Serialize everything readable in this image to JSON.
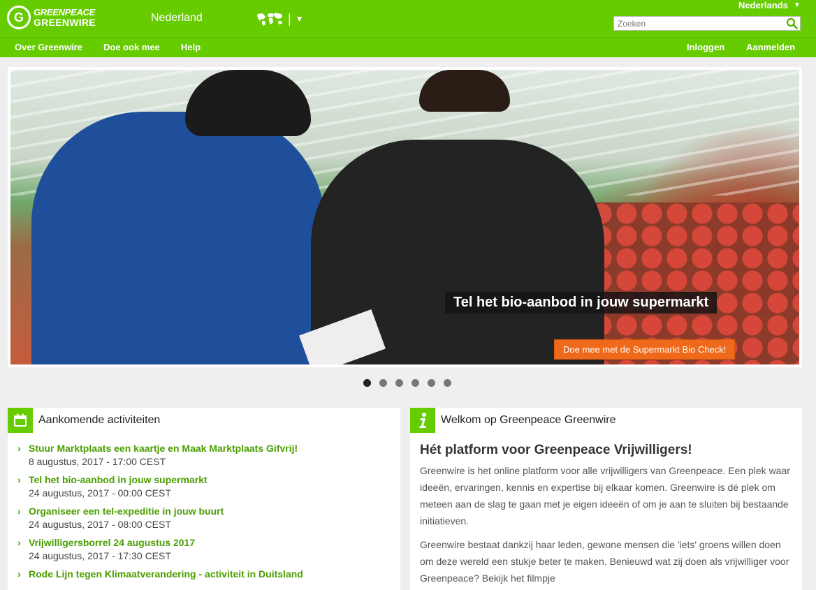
{
  "header": {
    "logo_line1": "GREENPEACE",
    "logo_line2": "GREENWIRE",
    "logo_mark": "G",
    "country": "Nederland",
    "language": "Nederlands",
    "search_placeholder": "Zoeken",
    "world_sep": "|"
  },
  "nav": {
    "left": [
      "Over Greenwire",
      "Doe ook mee",
      "Help"
    ],
    "right": [
      "Inloggen",
      "Aanmelden"
    ]
  },
  "hero": {
    "caption": "Tel het bio-aanbod in jouw supermarkt",
    "cta": "Doe mee met de Supermarkt Bio Check!",
    "slide_count": 6,
    "active_slide": 0
  },
  "activities": {
    "title": "Aankomende activiteiten",
    "items": [
      {
        "title": "Stuur Marktplaats een kaartje en Maak Marktplaats Gifvrij!",
        "date": "8 augustus, 2017 - 17:00 CEST"
      },
      {
        "title": "Tel het bio-aanbod in jouw supermarkt",
        "date": "24 augustus, 2017 - 00:00 CEST"
      },
      {
        "title": "Organiseer een tel-expeditie in jouw buurt",
        "date": "24 augustus, 2017 - 08:00 CEST"
      },
      {
        "title": "Vrijwilligersborrel 24 augustus 2017",
        "date": "24 augustus, 2017 - 17:30 CEST"
      },
      {
        "title": "Rode Lijn tegen Klimaatverandering - activiteit in Duitsland",
        "date": ""
      }
    ]
  },
  "welcome": {
    "title": "Welkom op Greenpeace Greenwire",
    "heading": "Hét platform voor Greenpeace Vrijwilligers!",
    "para1": "Greenwire is het online platform voor alle vrijwilligers van Greenpeace. Een plek waar ideeën, ervaringen, kennis en expertise bij elkaar komen. Greenwire is dé plek om meteen aan de slag te gaan met je eigen ideeën of om je aan te sluiten bij bestaande initiatieven.",
    "para2": "Greenwire bestaat dankzij haar leden, gewone mensen die 'iets' groens willen doen om deze wereld een stukje beter te maken. Benieuwd wat zij doen als vrijwilliger voor Greenpeace? Bekijk het filmpje"
  },
  "colors": {
    "brand_green": "#66cc00",
    "link_green": "#4a9e00",
    "cta_orange": "#ee6a1a"
  },
  "icons": {
    "logo": "greenpeace-logo-icon",
    "world": "world-map-icon",
    "search": "search-icon",
    "calendar": "calendar-icon",
    "info": "info-icon",
    "chevron": "chevron-right-icon"
  }
}
